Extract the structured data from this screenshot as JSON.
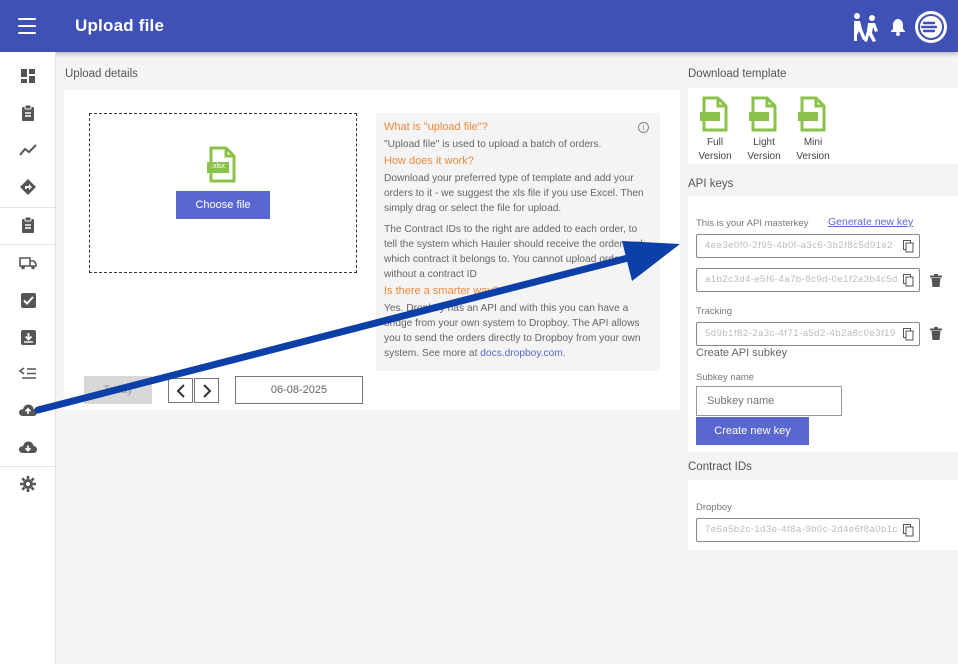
{
  "header": {
    "title": "Upload file"
  },
  "upload": {
    "section_label": "Upload details",
    "choose_label": "Choose file",
    "file_ext": ".xlsx",
    "today_label": "Today",
    "date_value": "06-08-2025"
  },
  "info": {
    "q1": "What is \"upload file\"?",
    "a1": "\"Upload file\" is used to upload a batch of orders.",
    "q2": "How does it work?",
    "a2": "Download your preferred type of template and add your orders to it - we suggest the xls file if you use Excel. Then simply drag or select the file for upload.",
    "a2b": "The Contract IDs to the right are added to each order, to tell the system which Hauler should receive the order and which contract it belongs to. You cannot upload orders without a contract ID",
    "q3": "Is there a smarter way?",
    "a3": "Yes. Dropboy has an API and with this you can have a bridge from your own system to Dropboy. The API allows you to send the orders directly to Dropboy from your own system. See more at",
    "link": "docs.dropboy.com"
  },
  "templates": {
    "section_label": "Download template",
    "items": [
      {
        "line1": "Full",
        "line2": "Version"
      },
      {
        "line1": "Light",
        "line2": "Version"
      },
      {
        "line1": "Mini",
        "line2": "Version"
      }
    ]
  },
  "api": {
    "section_label": "API keys",
    "master_label": "This is your API masterkey",
    "generate_link": "Generate new key",
    "master_value": "4ee3e0f0-2f95-4b0f-a3c6-3b2f8c5d91e2",
    "secondary_value": "a1b2c3d4-e5f6-4a7b-8c9d-0e1f2a3b4c5d",
    "tracking_label": "Tracking",
    "tracking_value": "5d9b1f82-2a3c-4f71-a5d2-4b2a8c0e3f19",
    "subkey_title": "Create API subkey",
    "subkey_name_label": "Subkey name",
    "subkey_placeholder": "Subkey name",
    "create_label": "Create new key"
  },
  "contracts": {
    "section_label": "Contract IDs",
    "dropboy_label": "Dropboy",
    "dropboy_value": "7e6a5b2c-1d3e-4f8a-9b0c-2d4e6f8a0b1c"
  },
  "colors": {
    "primary": "#3f51b5",
    "button": "#5a67d0",
    "accent_orange": "#f08a3c",
    "xlsx_green": "#8bc34a",
    "annotation_arrow": "#0d3fa8"
  }
}
